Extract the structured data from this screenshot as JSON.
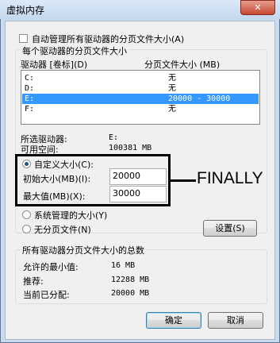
{
  "window": {
    "title": "虚拟内存",
    "close_glyph": "✕"
  },
  "auto_manage": {
    "label": "自动管理所有驱动器的分页文件大小(A)",
    "checked": false
  },
  "per_drive_group": {
    "title": "每个驱动器的分页文件大小"
  },
  "drive_list": {
    "col_drive": "驱动器 [卷标](D)",
    "col_size": "分页文件大小 (MB)",
    "rows": [
      {
        "drive": "C:",
        "size": "无"
      },
      {
        "drive": "D:",
        "size": "无"
      },
      {
        "drive": "E:",
        "size": "20000 - 30000"
      },
      {
        "drive": "F:",
        "size": "无"
      }
    ],
    "selected_index": 2
  },
  "selected_drive": {
    "label": "所选驱动器:",
    "value": "E:"
  },
  "available_space": {
    "label": "可用空间:",
    "value": "100381 MB"
  },
  "custom_size": {
    "label": "自定义大小(C):",
    "selected": true
  },
  "initial_size": {
    "label": "初始大小(MB)(I):",
    "value": "20000"
  },
  "max_size": {
    "label": "最大值(MB)(X):",
    "value": "30000"
  },
  "annotation": {
    "text": "FINALLY"
  },
  "system_managed": {
    "label": "系统管理的大小(Y)"
  },
  "no_paging": {
    "label": "无分页文件(N)"
  },
  "set_button": {
    "label": "设置(S)"
  },
  "total_group": {
    "title": "所有驱动器分页文件大小的总数",
    "min_label": "允许的最小值:",
    "min_value": "16 MB",
    "recommended_label": "推荐:",
    "recommended_value": "12288 MB",
    "current_label": "当前已分配:",
    "current_value": "20000 MB"
  },
  "ok_button": {
    "label": "确定"
  },
  "cancel_button": {
    "label": "取消"
  }
}
